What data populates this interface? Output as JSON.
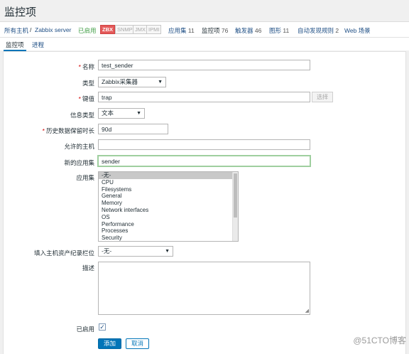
{
  "page": {
    "title": "监控项"
  },
  "hostbar": {
    "all_hosts": "所有主机",
    "separator": "/",
    "host": "Zabbix server",
    "status": "已启用",
    "badges": [
      "ZBX",
      "SNMP",
      "JMX",
      "IPMI"
    ],
    "applications": {
      "label": "应用集",
      "count": "11"
    },
    "items": {
      "label": "监控项",
      "count": "76"
    },
    "triggers": {
      "label": "触发器",
      "count": "46"
    },
    "graphs": {
      "label": "图形",
      "count": "11"
    },
    "discovery": {
      "label": "自动发现规则",
      "count": "2"
    },
    "web": {
      "label": "Web 场景"
    }
  },
  "tabs": {
    "item": "监控项",
    "process": "进程"
  },
  "form": {
    "name": {
      "label": "名称",
      "value": "test_sender"
    },
    "type": {
      "label": "类型",
      "value": "Zabbix采集器"
    },
    "key": {
      "label": "键值",
      "value": "trap",
      "select_button": "选择"
    },
    "info_type": {
      "label": "信息类型",
      "value": "文本"
    },
    "history": {
      "label": "历史数据保留时长",
      "value": "90d"
    },
    "allowed_hosts": {
      "label": "允许的主机",
      "value": ""
    },
    "new_application": {
      "label": "新的应用集",
      "value": "sender"
    },
    "applications": {
      "label": "应用集",
      "options": [
        "-无-",
        "CPU",
        "Filesystems",
        "General",
        "Memory",
        "Network interfaces",
        "OS",
        "Performance",
        "Processes",
        "Security"
      ],
      "selected": "-无-"
    },
    "inventory": {
      "label": "填入主机资产纪录栏位",
      "value": "-无-"
    },
    "description": {
      "label": "描述",
      "value": ""
    },
    "enabled": {
      "label": "已启用",
      "checked": true
    },
    "add_button": "添加",
    "cancel_button": "取消"
  },
  "watermark": "@51CTO博客"
}
